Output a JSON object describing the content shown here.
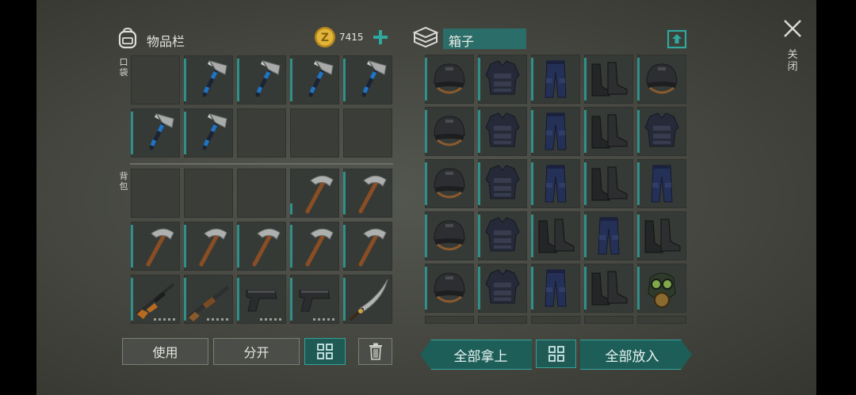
{
  "inventory": {
    "title": "物品栏",
    "currency_amount": "7415",
    "pocket_label": "口袋",
    "backpack_label": "背包"
  },
  "container": {
    "title": "箱子"
  },
  "close_label": "关闭",
  "buttons": {
    "use": "使用",
    "split": "分开",
    "take_all": "全部拿上",
    "put_all": "全部放入"
  },
  "colors": {
    "accent_teal": "#2f8f8a",
    "button_teal": "#1f5a55",
    "coin_gold": "#d8a92a"
  },
  "pocket_rows": [
    [
      "empty",
      "hatchet",
      "hatchet",
      "hatchet",
      "hatchet"
    ],
    [
      "hatchet",
      "hatchet",
      "empty",
      "empty",
      "empty"
    ]
  ],
  "backpack_rows": [
    [
      "empty",
      "empty",
      "empty",
      "pickaxe",
      "pickaxe"
    ],
    [
      "pickaxe",
      "pickaxe",
      "pickaxe",
      "pickaxe",
      "pickaxe"
    ],
    [
      "rifle",
      "shotgun",
      "pistol",
      "pistol",
      "machete"
    ]
  ],
  "box_rows": [
    [
      "helmet",
      "armor",
      "pants",
      "boots",
      "helmet"
    ],
    [
      "helmet",
      "armor",
      "pants",
      "boots",
      "armor"
    ],
    [
      "helmet",
      "armor",
      "pants",
      "boots",
      "pants"
    ],
    [
      "helmet",
      "armor",
      "boots",
      "pants",
      "boots"
    ],
    [
      "helmet",
      "armor",
      "pants",
      "boots",
      "gasmask"
    ]
  ]
}
